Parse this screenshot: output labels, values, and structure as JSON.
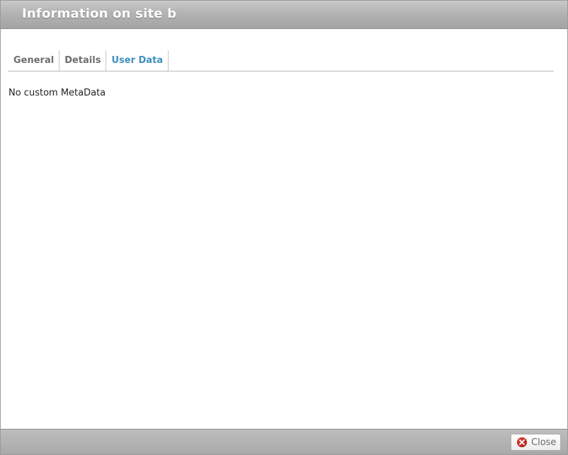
{
  "dialog": {
    "title": "Information on site b"
  },
  "tabs": [
    {
      "label": "General",
      "active": false
    },
    {
      "label": "Details",
      "active": false
    },
    {
      "label": "User Data",
      "active": true
    }
  ],
  "content": {
    "message": "No custom MetaData"
  },
  "footer": {
    "close_label": "Close",
    "close_icon": "close-icon"
  },
  "colors": {
    "active_tab": "#3f8fbd",
    "inactive_tab": "#6e6e6e",
    "close_icon": "#c0261a"
  }
}
